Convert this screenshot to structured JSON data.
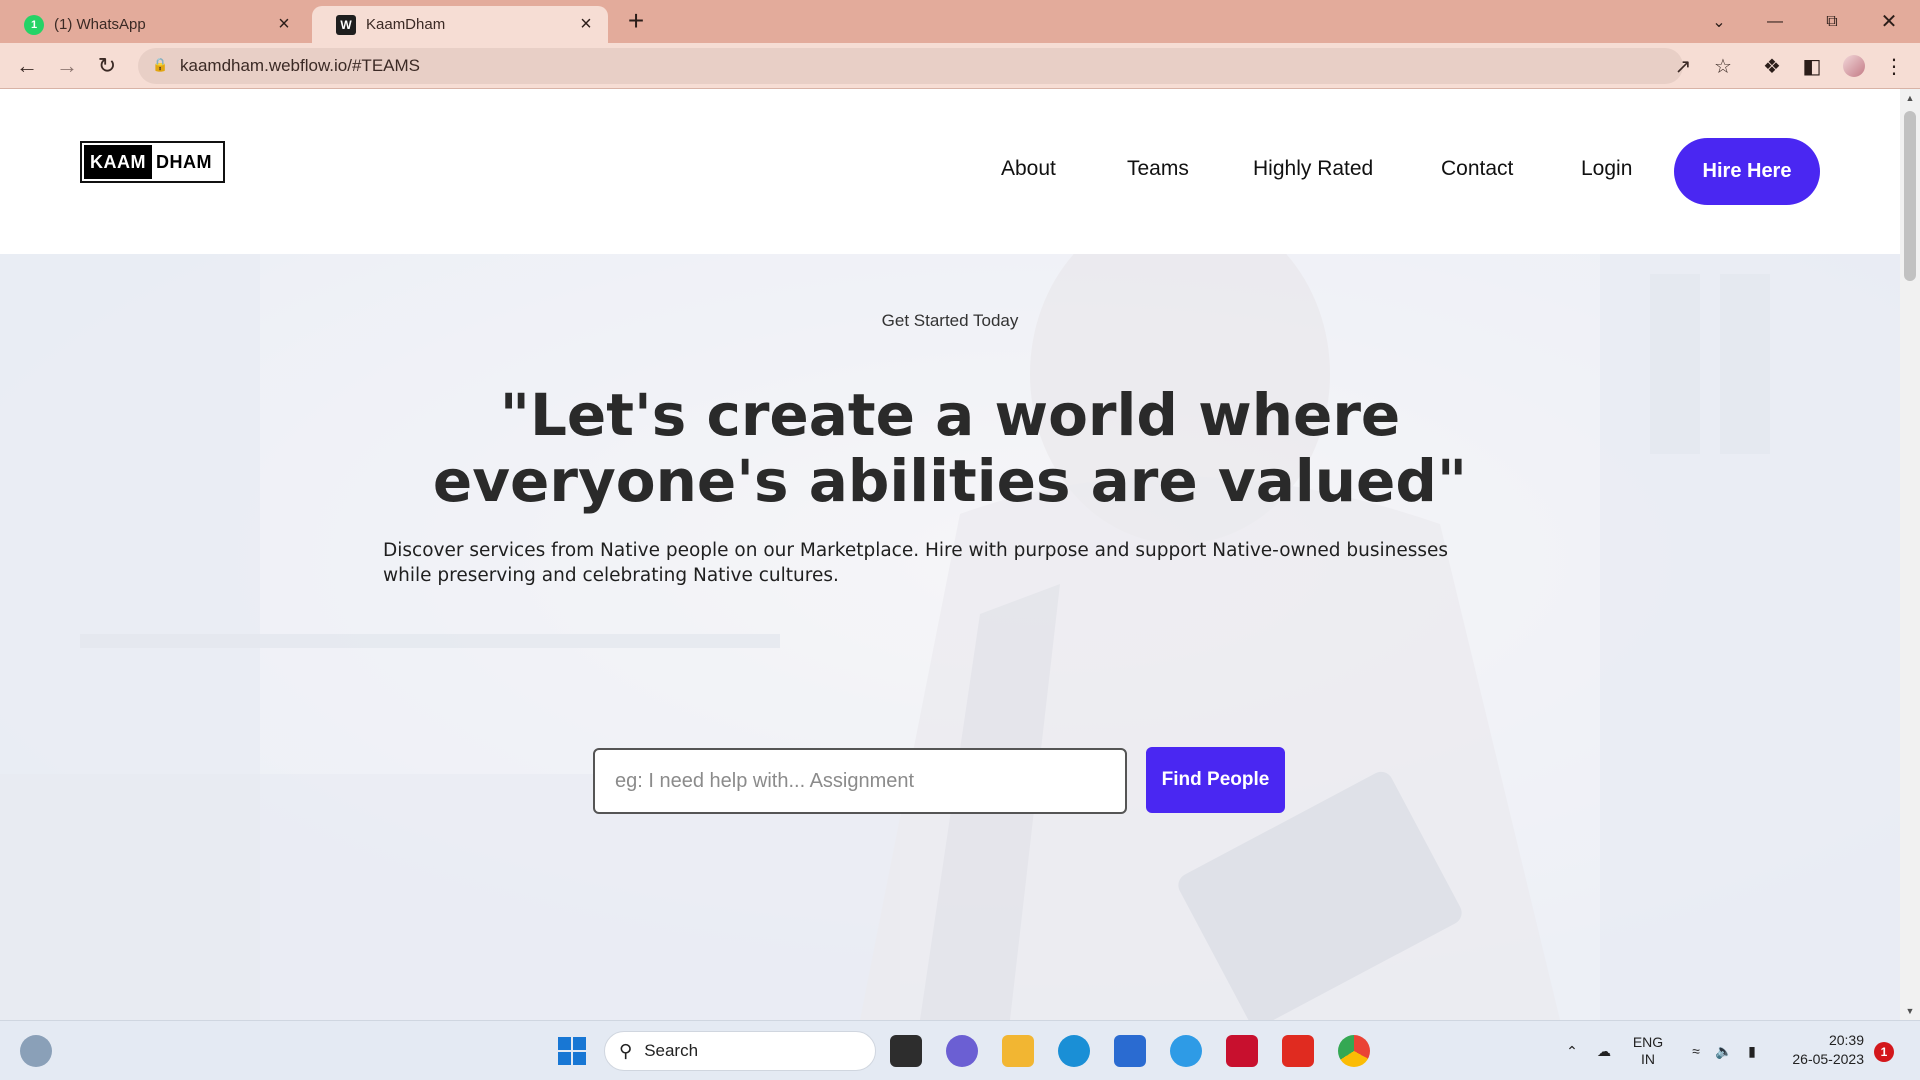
{
  "browser": {
    "tabs": [
      {
        "title": "(1) WhatsApp",
        "favicon": "1"
      },
      {
        "title": "KaamDham",
        "favicon": "W"
      }
    ],
    "url": "kaamdham.webflow.io/#TEAMS",
    "new_tab_label": "+",
    "close_label": "×"
  },
  "site": {
    "logo": {
      "left": "KAAM",
      "right": "DHAM"
    },
    "nav": {
      "about": "About",
      "teams": "Teams",
      "highly_rated": "Highly Rated",
      "contact": "Contact",
      "login": "Login",
      "hire": "Hire Here"
    },
    "hero": {
      "tagline": "Get Started Today",
      "headline": "\"Let's create a world where everyone's abilities are valued\"",
      "subtext": "Discover services from Native people on our Marketplace. Hire with purpose and support Native-owned businesses while preserving and celebrating Native cultures.",
      "search_placeholder": "eg: I need help with... Assignment",
      "find_button": "Find People"
    }
  },
  "taskbar": {
    "search_label": "Search",
    "language": "ENG",
    "region": "IN",
    "time": "20:39",
    "date": "26-05-2023",
    "notification_count": "1"
  },
  "colors": {
    "accent": "#4a27f2",
    "tabbar": "#e3ab9b",
    "toolbar": "#f6ddd4"
  }
}
